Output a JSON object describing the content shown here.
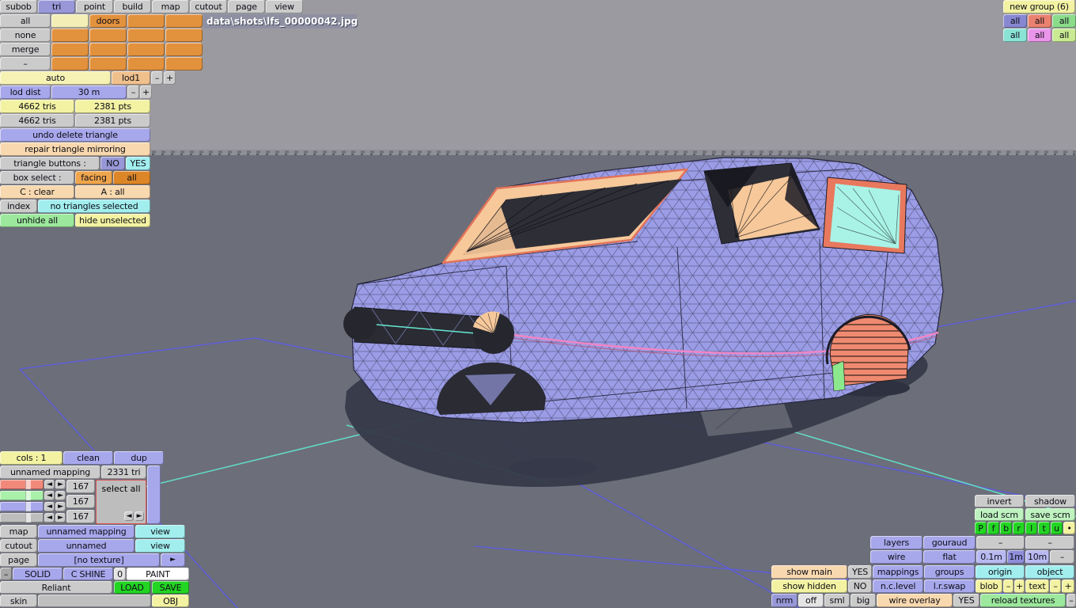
{
  "window": {
    "filename": "data\\shots\\lfs_00000042.jpg"
  },
  "tabs": [
    "subob",
    "tri",
    "point",
    "build",
    "map",
    "cutout",
    "page",
    "view"
  ],
  "subob": {
    "rows": [
      "all",
      "none",
      "merge",
      "–"
    ],
    "cell_doors": "doors"
  },
  "lod": {
    "auto": "auto",
    "lod": "lod1",
    "minus": "–",
    "plus": "+",
    "dist_label": "lod dist",
    "dist": "30 m"
  },
  "stats": {
    "tris_a": "4662 tris",
    "pts_a": "2381 pts",
    "tris_b": "4662 tris",
    "pts_b": "2381 pts"
  },
  "tools": {
    "undo": "undo delete triangle",
    "repair": "repair triangle mirroring",
    "tb_label": "triangle buttons :",
    "no": "NO",
    "yes": "YES",
    "bs_label": "box select :",
    "facing": "facing",
    "all": "all",
    "c_clear": "C : clear",
    "a_all": "A : all",
    "index": "index",
    "selection": "no triangles selected",
    "unhide": "unhide all",
    "hide": "hide unselected"
  },
  "groups": {
    "new_group": "new group (6)",
    "row1": [
      "all",
      "all",
      "all"
    ],
    "row2": [
      "all",
      "all",
      "all"
    ]
  },
  "mapping": {
    "cols": "cols : 1",
    "clean": "clean",
    "dup": "dup",
    "name": "unnamed mapping",
    "count": "2331 tri",
    "v1": "167",
    "v2": "167",
    "v3": "167",
    "select_all": "select all",
    "left": "◄",
    "right": "►"
  },
  "texture": {
    "map": "map",
    "map_val": "unnamed mapping",
    "view": "view",
    "cutout": "cutout",
    "cutout_val": "unnamed",
    "view2": "view",
    "page": "page",
    "page_val": "[no texture]",
    "arrow": "►",
    "minus": "–",
    "solid": "SOLID",
    "cshine": "C SHINE",
    "zero": "0",
    "paint": "PAINT",
    "model": "Reliant",
    "load": "LOAD",
    "save": "SAVE",
    "skin": "skin",
    "obj": "OBJ"
  },
  "view_panel": {
    "invert": "invert",
    "shadow": "shadow",
    "load_scm": "load scm",
    "save_scm": "save scm",
    "presets": [
      "P",
      "f",
      "b",
      "r",
      "l",
      "t",
      "u",
      "•"
    ],
    "layers": "layers",
    "gouraud": "gouraud",
    "m1": "–",
    "m2": "–",
    "wire": "wire",
    "flat": "flat",
    "d01": "0.1m",
    "d1": "1m",
    "d10": "10m",
    "m3": "–",
    "show_main": "show main",
    "yes": "YES",
    "mappings": "mappings",
    "groups": "groups",
    "origin": "origin",
    "object": "object",
    "show_hidden": "show hidden",
    "no": "NO",
    "nclevel": "n.c.level",
    "lrswap": "l.r.swap",
    "blob": "blob",
    "bm": "–",
    "bp": "+",
    "text": "text",
    "tm": "–",
    "tp": "+",
    "nrm": "nrm",
    "off": "off",
    "sml": "sml",
    "big": "big",
    "overlay": "wire overlay",
    "yes2": "YES",
    "reload": "reload textures",
    "m4": "–"
  }
}
